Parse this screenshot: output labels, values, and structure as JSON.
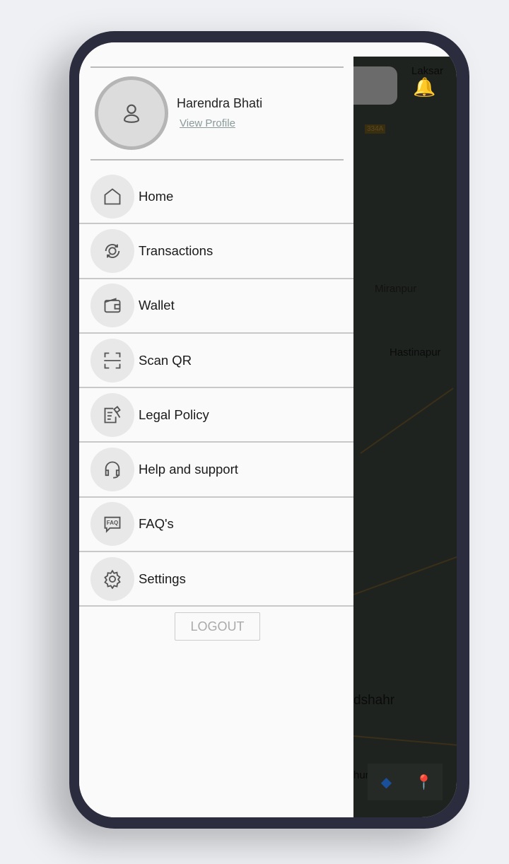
{
  "profile": {
    "name": "Harendra Bhati",
    "view_profile": "View Profile"
  },
  "menu": [
    {
      "label": "Home",
      "icon": "home-icon"
    },
    {
      "label": "Transactions",
      "icon": "transactions-icon"
    },
    {
      "label": "Wallet",
      "icon": "wallet-icon"
    },
    {
      "label": "Scan QR",
      "icon": "scan-qr-icon"
    },
    {
      "label": "Legal Policy",
      "icon": "legal-icon"
    },
    {
      "label": "Help and support",
      "icon": "headset-icon"
    },
    {
      "label": "FAQ's",
      "icon": "faq-icon"
    },
    {
      "label": "Settings",
      "icon": "gear-icon"
    }
  ],
  "logout": "LOGOUT",
  "faq_icon_text": "FAQ",
  "map": {
    "labels": [
      "Laksar",
      "334A",
      "Miranpur",
      "Hastinapur",
      "dshahr",
      "hurj"
    ]
  },
  "colors": {
    "map_bg": "#1f231f",
    "drawer_bg": "#fafafa"
  }
}
